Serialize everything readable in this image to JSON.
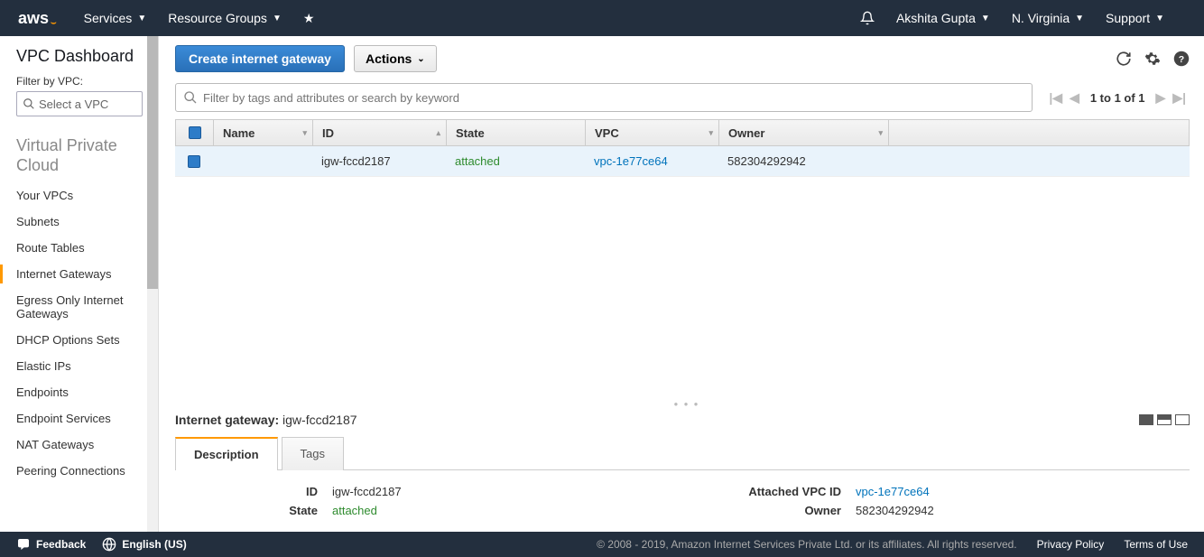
{
  "topnav": {
    "logo": "aws",
    "services": "Services",
    "resource_groups": "Resource Groups",
    "user": "Akshita Gupta",
    "region": "N. Virginia",
    "support": "Support"
  },
  "sidebar": {
    "title": "VPC Dashboard",
    "filter_label": "Filter by VPC:",
    "filter_placeholder": "Select a VPC",
    "section": "Virtual Private Cloud",
    "items": [
      "Your VPCs",
      "Subnets",
      "Route Tables",
      "Internet Gateways",
      "Egress Only Internet Gateways",
      "DHCP Options Sets",
      "Elastic IPs",
      "Endpoints",
      "Endpoint Services",
      "NAT Gateways",
      "Peering Connections"
    ],
    "active_index": 3
  },
  "toolbar": {
    "primary": "Create internet gateway",
    "actions": "Actions"
  },
  "search": {
    "placeholder": "Filter by tags and attributes or search by keyword"
  },
  "pager": {
    "text": "1 to 1 of 1"
  },
  "table": {
    "headers": [
      "Name",
      "ID",
      "State",
      "VPC",
      "Owner"
    ],
    "row": {
      "name": "",
      "id": "igw-fccd2187",
      "state": "attached",
      "vpc": "vpc-1e77ce64",
      "owner": "582304292942"
    }
  },
  "detail": {
    "title_label": "Internet gateway:",
    "title_value": "igw-fccd2187",
    "tabs": [
      "Description",
      "Tags"
    ],
    "fields": {
      "id_label": "ID",
      "id_value": "igw-fccd2187",
      "state_label": "State",
      "state_value": "attached",
      "vpc_label": "Attached VPC ID",
      "vpc_value": "vpc-1e77ce64",
      "owner_label": "Owner",
      "owner_value": "582304292942"
    }
  },
  "footer": {
    "feedback": "Feedback",
    "language": "English (US)",
    "copyright": "© 2008 - 2019, Amazon Internet Services Private Ltd. or its affiliates. All rights reserved.",
    "privacy": "Privacy Policy",
    "terms": "Terms of Use"
  }
}
